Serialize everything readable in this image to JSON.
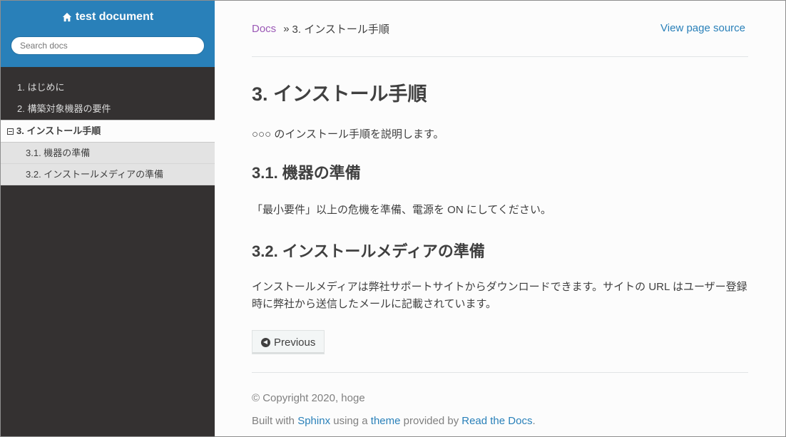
{
  "sidebar": {
    "project_name": "test document",
    "search_placeholder": "Search docs",
    "nav": {
      "item1": "1. はじめに",
      "item2": "2. 構築対象機器の要件",
      "current": "3. インストール手順",
      "sub1": "3.1. 機器の準備",
      "sub2": "3.2. インストールメディアの準備"
    }
  },
  "breadcrumbs": {
    "docs": "Docs",
    "separator": "»",
    "current": "3. インストール手順",
    "view_source": "View page source"
  },
  "content": {
    "h1": "3. インストール手順",
    "intro": "○○○ のインストール手順を説明します。",
    "s1_title": "3.1. 機器の準備",
    "s1_text": "「最小要件」以上の危機を準備、電源を ON にしてください。",
    "s2_title": "3.2. インストールメディアの準備",
    "s2_text": "インストールメディアは弊社サポートサイトからダウンロードできます。サイトの URL はユーザー登録時に弊社から送信したメールに記載されています。",
    "prev_button": "Previous"
  },
  "footer": {
    "copyright": "© Copyright 2020, hoge",
    "built_with": "Built with",
    "sphinx": "Sphinx",
    "using_a": "using a",
    "theme": "theme",
    "provided_by": "provided by",
    "rtd": "Read the Docs",
    "period": "."
  },
  "icons": {
    "home": "home-icon",
    "toggle": "minus-square-icon",
    "previous": "circle-arrow-left-icon"
  },
  "colors": {
    "sidebar_top": "#2980b9",
    "sidebar_bg": "#343131",
    "link": "#2980b9",
    "visited_link": "#9b59b6"
  }
}
